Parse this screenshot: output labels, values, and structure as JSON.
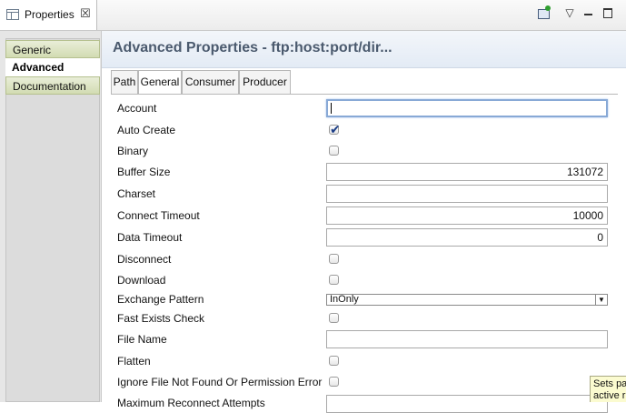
{
  "view": {
    "tab_title": "Properties",
    "close_glyph": "☒",
    "menu_glyph": "▽",
    "icons": [
      "properties-icon",
      "pin-editor-icon",
      "view-menu-icon",
      "minimize-icon",
      "maximize-icon"
    ]
  },
  "categories": [
    {
      "label": "Generic"
    },
    {
      "label": "Advanced"
    },
    {
      "label": "Documentation"
    }
  ],
  "header": {
    "title": "Advanced Properties - ftp:host:port/dir..."
  },
  "tabs": [
    {
      "label": "Path"
    },
    {
      "label": "General"
    },
    {
      "label": "Consumer"
    },
    {
      "label": "Producer"
    }
  ],
  "active_tab": "General",
  "fields": {
    "account": {
      "label": "Account",
      "value": ""
    },
    "auto_create": {
      "label": "Auto Create",
      "checked": true
    },
    "binary": {
      "label": "Binary",
      "checked": false
    },
    "buffer_size": {
      "label": "Buffer Size",
      "value": "131072"
    },
    "charset": {
      "label": "Charset",
      "value": ""
    },
    "connect_timeout": {
      "label": "Connect Timeout",
      "value": "10000"
    },
    "data_timeout": {
      "label": "Data Timeout",
      "value": "0"
    },
    "disconnect": {
      "label": "Disconnect",
      "checked": false
    },
    "download": {
      "label": "Download",
      "checked": false
    },
    "exchange_pattern": {
      "label": "Exchange Pattern",
      "value": "InOnly"
    },
    "fast_exists_check": {
      "label": "Fast Exists Check",
      "checked": false
    },
    "file_name": {
      "label": "File Name",
      "value": ""
    },
    "flatten": {
      "label": "Flatten",
      "checked": false
    },
    "ignore_file_not_found": {
      "label": "Ignore File Not Found Or Permission Error",
      "checked": false
    },
    "max_reconnect": {
      "label": "Maximum Reconnect Attempts",
      "value": ""
    }
  },
  "tooltip": {
    "text": "Sets pa\nactive r"
  },
  "colors": {
    "header_title": "#4b5a6e",
    "category_bg": "#d2dcb2",
    "focus_ring": "#88a9d6"
  }
}
